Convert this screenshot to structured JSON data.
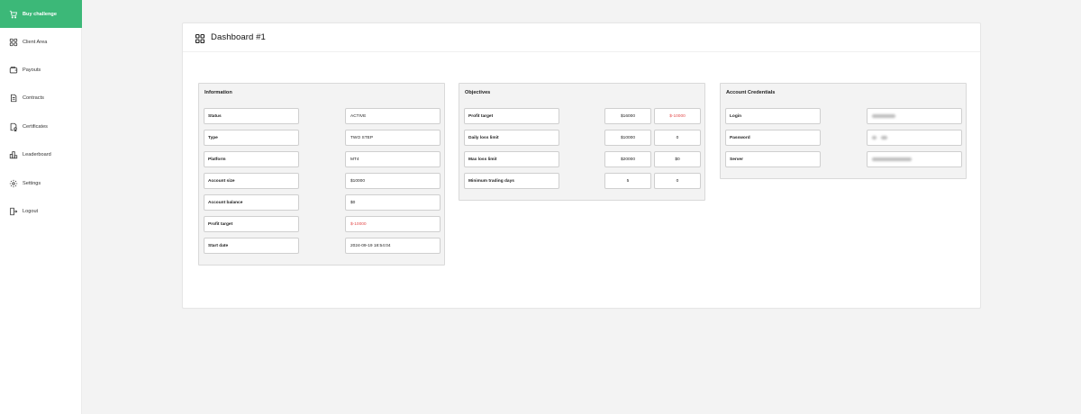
{
  "sidebar": {
    "items": [
      {
        "label": "Buy challenge",
        "icon": "cart-icon"
      },
      {
        "label": "Client Area",
        "icon": "grid-icon"
      },
      {
        "label": "Payouts",
        "icon": "wallet-icon"
      },
      {
        "label": "Contracts",
        "icon": "document-icon"
      },
      {
        "label": "Certificates",
        "icon": "certificate-icon"
      },
      {
        "label": "Leaderboard",
        "icon": "leaderboard-icon"
      },
      {
        "label": "Settings",
        "icon": "gear-icon"
      },
      {
        "label": "Logout",
        "icon": "logout-icon"
      }
    ]
  },
  "header": {
    "title": "Dashboard #1",
    "icon": "dashboard-grid-icon"
  },
  "information": {
    "title": "Information",
    "rows": [
      {
        "label": "Status",
        "value": "ACTIVE"
      },
      {
        "label": "Type",
        "value": "TWO STEP"
      },
      {
        "label": "Platform",
        "value": "MT4"
      },
      {
        "label": "Account size",
        "value": "$10000"
      },
      {
        "label": "Account balance",
        "value": "$0"
      },
      {
        "label": "Profit target",
        "value": "$-10000"
      },
      {
        "label": "Start date",
        "value": "2024-09-19 18:54:04"
      }
    ]
  },
  "objectives": {
    "title": "Objectives",
    "rows": [
      {
        "label": "Profit target",
        "target": "$16000",
        "current": "$-10000"
      },
      {
        "label": "Daily loss limit",
        "target": "$10000",
        "current": "0"
      },
      {
        "label": "Max loss limit",
        "target": "$20000",
        "current": "$0"
      },
      {
        "label": "Minimum trading days",
        "target": "5",
        "current": "0"
      }
    ]
  },
  "credentials": {
    "title": "Account Credentials",
    "rows": [
      {
        "label": "Login"
      },
      {
        "label": "Password"
      },
      {
        "label": "Server"
      }
    ]
  },
  "colors": {
    "accent": "#3cb878",
    "negative": "#e34b4b"
  }
}
